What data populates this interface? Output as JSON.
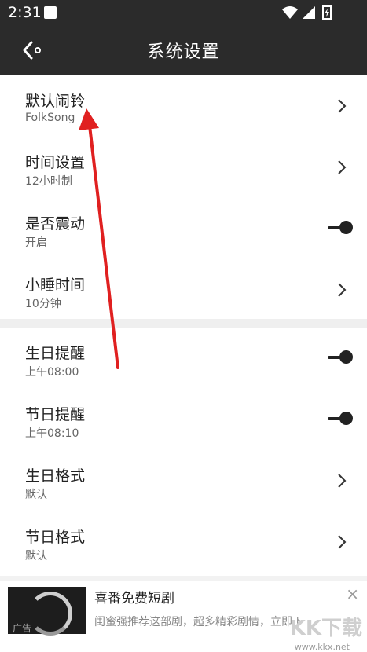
{
  "status_bar": {
    "time": "2:31"
  },
  "header": {
    "title": "系统设置"
  },
  "settings": [
    {
      "title": "默认闹铃",
      "value": "FolkSong",
      "control": "chevron"
    },
    {
      "title": "时间设置",
      "value": "12小时制",
      "control": "chevron"
    },
    {
      "title": "是否震动",
      "value": "开启",
      "control": "toggle"
    },
    {
      "title": "小睡时间",
      "value": "10分钟",
      "control": "chevron"
    },
    {
      "title": "生日提醒",
      "value": "上午08:00",
      "control": "toggle"
    },
    {
      "title": "节日提醒",
      "value": "上午08:10",
      "control": "toggle"
    },
    {
      "title": "生日格式",
      "value": "默认",
      "control": "chevron"
    },
    {
      "title": "节日格式",
      "value": "默认",
      "control": "chevron"
    }
  ],
  "ad": {
    "label": "广告",
    "title": "喜番免费短剧",
    "description": "闺蜜强推荐这部剧，超多精彩剧情，立即下",
    "close": "×"
  },
  "watermark": {
    "text": "KK下载",
    "url": "www.kkx.net"
  },
  "colors": {
    "header_bg": "#2b2b2b",
    "arrow": "#e02020"
  }
}
